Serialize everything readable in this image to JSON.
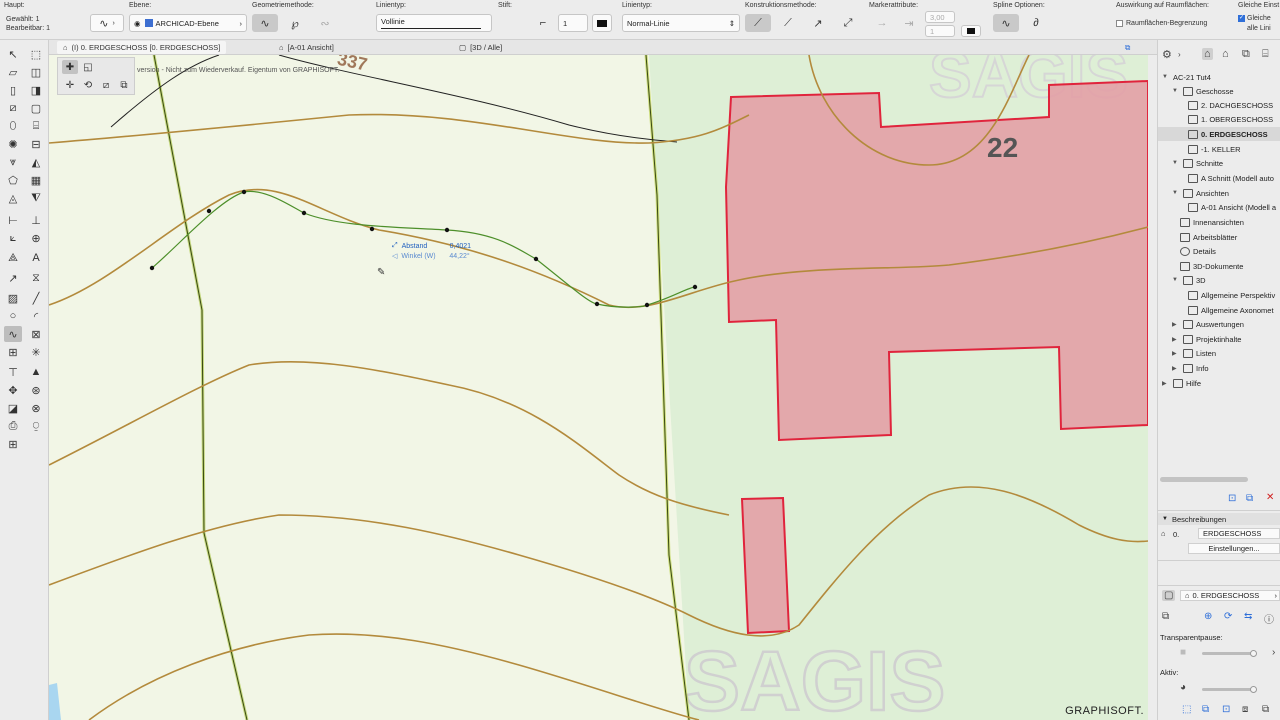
{
  "infobox": {
    "haupt": {
      "title": "Haupt:",
      "selected": "Gewählt: 1",
      "editable": "Bearbeitbar: 1"
    },
    "ebene": {
      "title": "Ebene:",
      "value": "ARCHICAD-Ebene"
    },
    "geometrie": {
      "title": "Geometriemethode:"
    },
    "linientyp1": {
      "title": "Linientyp:",
      "value": "Vollinie"
    },
    "stift": {
      "title": "Stift:",
      "value": "1"
    },
    "linientyp2": {
      "title": "Linientyp:",
      "value": "Normal-Linie"
    },
    "konstruktion": {
      "title": "Konstruktionsmethode:"
    },
    "marker": {
      "title": "Markerattribute:",
      "size": "3,00",
      "pen": "1"
    },
    "spline": {
      "title": "Spline Optionen:"
    },
    "auswirkung": {
      "title": "Auswirkung auf Raumflächen:",
      "checkbox": "Raumflächen-Begrenzung"
    },
    "gleiche": {
      "title": "Gleiche Einst",
      "line1": "Gleiche",
      "line2": "alle Lini"
    }
  },
  "tabs": [
    {
      "label": "(I) 0. ERDGESCHOSS [0. ERDGESCHOSS]"
    },
    {
      "label": "[A-01 Ansicht]"
    },
    {
      "label": "[3D / Alle]"
    }
  ],
  "canvas": {
    "notice": "version - Nicht zum Wiederverkauf. Eigentum von GRAPHISOFT.",
    "label_22": "22",
    "label_top": "337",
    "watermark_top": "SAGIS",
    "watermark_bottom": "SAGIS",
    "brand": "GRAPHISOFT.",
    "tracker": {
      "distance_label": "Abstand",
      "distance_value": "0,4021",
      "angle_label": "Winkel (W)",
      "angle_value": "44,22°"
    }
  },
  "navigator": {
    "tree": [
      {
        "label": "AC-21 Tut4"
      },
      {
        "label": "Geschosse"
      },
      {
        "label": "2. DACHGESCHOSS"
      },
      {
        "label": "1. OBERGESCHOSS"
      },
      {
        "label": "0. ERDGESCHOSS"
      },
      {
        "label": "-1. KELLER"
      },
      {
        "label": "Schnitte"
      },
      {
        "label": "A Schnitt (Modell auto"
      },
      {
        "label": "Ansichten"
      },
      {
        "label": "A-01 Ansicht (Modell a"
      },
      {
        "label": "Innenansichten"
      },
      {
        "label": "Arbeitsblätter"
      },
      {
        "label": "Details"
      },
      {
        "label": "3D-Dokumente"
      },
      {
        "label": "3D"
      },
      {
        "label": "Allgemeine Perspektiv"
      },
      {
        "label": "Allgemeine Axonomet"
      },
      {
        "label": "Auswertungen"
      },
      {
        "label": "Projektinhalte"
      },
      {
        "label": "Listen"
      },
      {
        "label": "Info"
      },
      {
        "label": "Hilfe"
      }
    ],
    "beschreibungen": {
      "title": "Beschreibungen",
      "number": "0.",
      "name": "ERDGESCHOSS",
      "settings": "Einstellungen..."
    },
    "layer_panel": {
      "story": "0. ERDGESCHOSS",
      "transparent_label": "Transparentpause:",
      "aktiv_label": "Aktiv:"
    }
  },
  "colors": {
    "contour": "#b38a3c",
    "building_fill": "#e3a0a6",
    "building_stroke": "#e0243c",
    "spline": "#4d8f2a",
    "road": "#7a9a1a"
  }
}
